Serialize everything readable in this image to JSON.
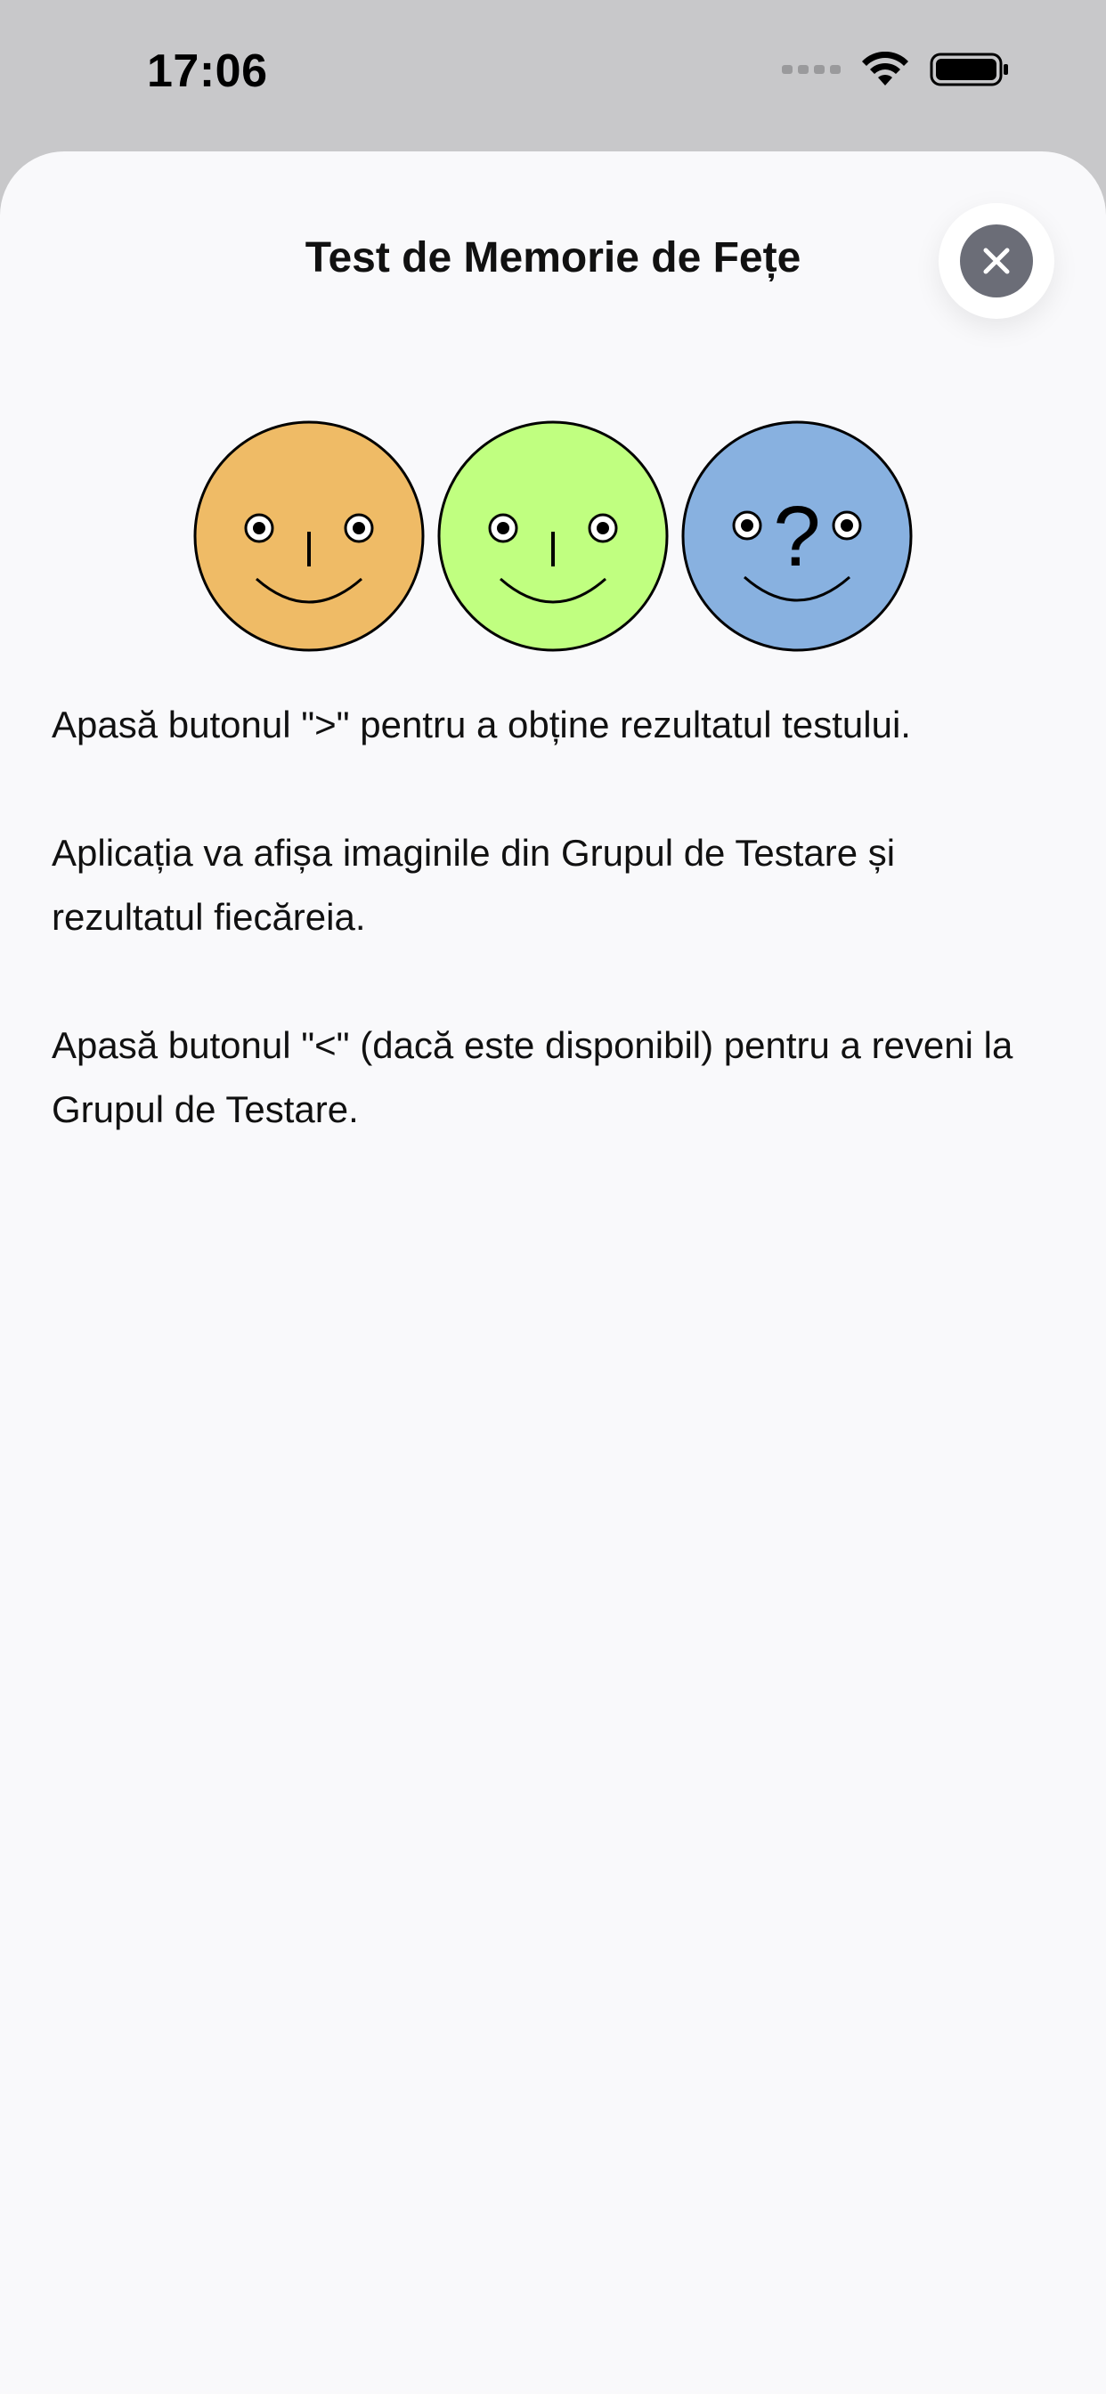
{
  "status_bar": {
    "time": "17:06"
  },
  "sheet": {
    "title": "Test de Memorie de Fețe",
    "close_icon": "xmark-circle-icon"
  },
  "faces": [
    {
      "color": "#efbb66",
      "mark": ""
    },
    {
      "color": "#c0ff80",
      "mark": ""
    },
    {
      "color": "#88b1e0",
      "mark": "?"
    }
  ],
  "instructions": [
    "Apasă butonul \">\" pentru a obține rezultatul testului.",
    "Aplicația va afișa imaginile din Grupul de Testare și rezultatul fiecăreia.",
    "Apasă butonul \"<\" (dacă este disponibil) pentru a reveni la Grupul de Testare."
  ]
}
